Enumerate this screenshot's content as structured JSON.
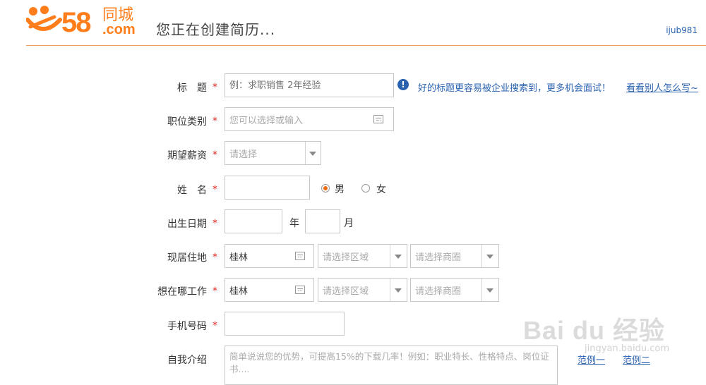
{
  "header": {
    "logo_number": "58",
    "logo_city": "同城",
    "logo_domain": ".com",
    "title": "您正在创建简历...",
    "username": "ijub981"
  },
  "required_mark": "*",
  "form": {
    "title": {
      "label": "标　题",
      "placeholder": "例：求职销售 2年经验",
      "tip": "好的标题更容易被企业搜索到，更多机会面试！",
      "tip_link": "看看别人怎么写~"
    },
    "job_category": {
      "label": "职位类别",
      "placeholder": "您可以选择或输入"
    },
    "salary": {
      "label": "期望薪资",
      "selected": "请选择"
    },
    "name": {
      "label": "姓　名",
      "value": "",
      "gender_options": [
        {
          "label": "男",
          "checked": true
        },
        {
          "label": "女",
          "checked": false
        }
      ]
    },
    "birth": {
      "label": "出生日期",
      "year_unit": "年",
      "month_unit": "月"
    },
    "residence": {
      "label": "现居住地",
      "city": "桂林",
      "district": "请选择区域",
      "area": "请选择商圈"
    },
    "work_location": {
      "label": "想在哪工作",
      "city": "桂林",
      "district": "请选择区域",
      "area": "请选择商圈"
    },
    "phone": {
      "label": "手机号码",
      "value": ""
    },
    "intro": {
      "label": "自我介绍",
      "placeholder": "简单说说您的优势，可提高15%的下载几率！例如：职业特长、性格特点、岗位证书....",
      "example1": "范例一",
      "example2": "范例二"
    }
  },
  "watermark": {
    "brand": "Bai du 经验",
    "url": "jingyan.baidu.com"
  },
  "colors": {
    "brand_orange": "#ff7d1a",
    "link_blue": "#2a62b0",
    "required_red": "#e02020"
  }
}
